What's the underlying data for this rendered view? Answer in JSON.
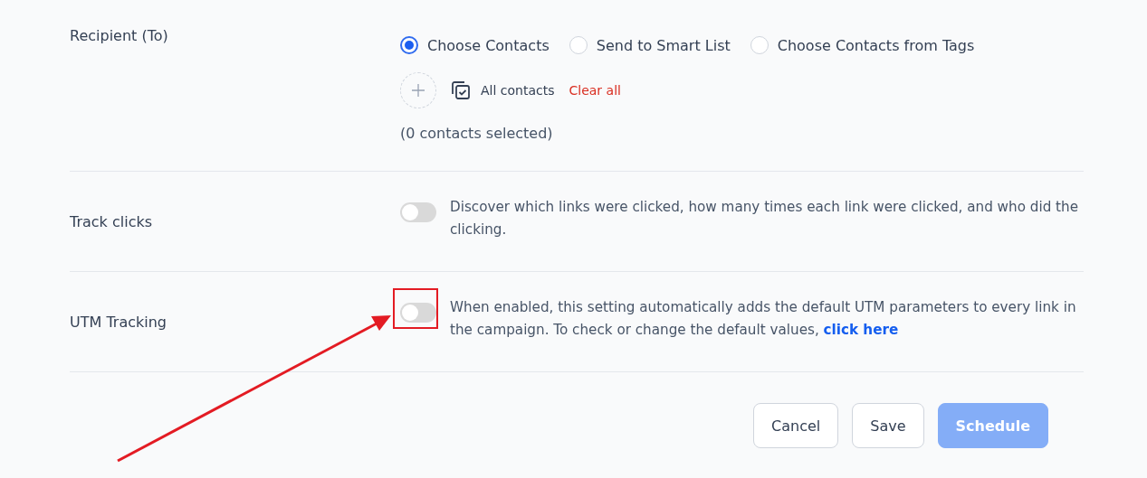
{
  "recipient": {
    "label": "Recipient (To)",
    "options": [
      {
        "label": "Choose Contacts",
        "selected": true
      },
      {
        "label": "Send to Smart List",
        "selected": false
      },
      {
        "label": "Choose Contacts from Tags",
        "selected": false
      }
    ],
    "all_contacts": "All contacts",
    "clear_all": "Clear all",
    "count": "(0 contacts selected)"
  },
  "settings": [
    {
      "label": "Track clicks",
      "on": false,
      "description": "Discover which links were clicked, how many times each link were clicked, and who did the clicking.",
      "highlighted": false
    },
    {
      "label": "UTM Tracking",
      "on": false,
      "description": "When enabled, this setting automatically adds the default UTM parameters to every link in the campaign. To check or change the default values,",
      "link": "click here",
      "highlighted": true
    }
  ],
  "buttons": [
    {
      "label": "Cancel",
      "kind": "secondary",
      "disabled": false
    },
    {
      "label": "Save",
      "kind": "secondary",
      "disabled": false
    },
    {
      "label": "Schedule",
      "kind": "primary",
      "disabled": true
    }
  ]
}
